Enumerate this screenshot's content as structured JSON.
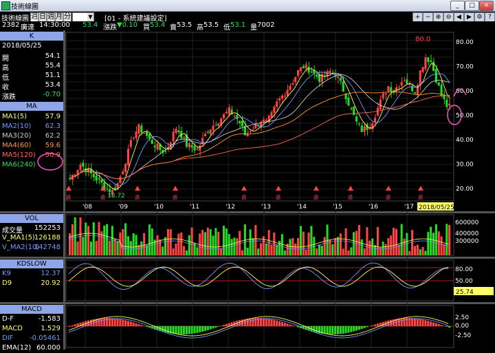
{
  "window": {
    "title": "技術線圖",
    "minimize": "_",
    "maximize": "□",
    "close": "×"
  },
  "toolbar": {
    "label": "技術線圖",
    "periods": [
      {
        "label": "週",
        "active": true
      },
      {
        "label": "日",
        "active": false
      },
      {
        "label": "週",
        "active": false
      },
      {
        "label": "月",
        "active": false
      },
      {
        "label": "分",
        "active": false
      }
    ],
    "settings": "[01 - 系統建議設定]"
  },
  "quote": {
    "code": "2382",
    "name": "廣達",
    "time": "14:30:00",
    "price": "53.4",
    "chg_label": "漲跌",
    "chg": "▼0.10",
    "bid_label": "買",
    "bid": "53.4",
    "ask_label": "賣",
    "ask": "53.5",
    "high_label": "高",
    "high": "53.5",
    "low_label": "低",
    "low": "53.1",
    "vol_label": "量",
    "vol": "7002"
  },
  "k_panel": {
    "header": "K",
    "date": "2018/05/25",
    "rows": [
      [
        "開",
        "54.1"
      ],
      [
        "高",
        "55.4"
      ],
      [
        "低",
        "51.1"
      ],
      [
        "收",
        "53.4"
      ],
      [
        "漲跌",
        "-0.70"
      ]
    ]
  },
  "ma_panel": {
    "header": "MA",
    "rows": [
      [
        "MA1(5)",
        "57.9",
        "#ffff66"
      ],
      [
        "MA2(10)",
        "62.3",
        "#6f9cff"
      ],
      [
        "MA3(20)",
        "62.2",
        "#cccccc"
      ],
      [
        "MA4(60)",
        "59.6",
        "#ff9933"
      ],
      [
        "MA5(120)",
        "50.9",
        "#ff6655"
      ],
      [
        "MA6(240)",
        "",
        "#33dd55"
      ]
    ]
  },
  "vol_panel": {
    "header": "VOL",
    "rows": [
      [
        "成交量",
        "152253",
        "#ffffff"
      ],
      [
        "V_MA1(5)",
        "126188",
        "#ffff66"
      ],
      [
        "V_MA2(10)",
        "142748",
        "#6f9cff"
      ]
    ]
  },
  "kd_panel": {
    "header": "KDSLOW",
    "rows": [
      [
        "K9",
        "12.37",
        "#6f9cff"
      ],
      [
        "D9",
        "20.92",
        "#ffff66"
      ]
    ]
  },
  "macd_panel": {
    "header": "MACD",
    "rows": [
      [
        "D-F",
        "-1.583",
        "#ffffff"
      ],
      [
        "MACD",
        "1.529",
        "#ffff66"
      ],
      [
        "DIF",
        "-0.05461",
        "#6f9cff"
      ],
      [
        "EMA(12)",
        "60.000",
        "#ffffff"
      ]
    ]
  },
  "chart_data": {
    "type": "candlestick",
    "years": [
      "'08",
      "'09",
      "'10",
      "'11",
      "'12",
      "'13",
      "'14",
      "'15",
      "'16",
      "'17"
    ],
    "current_date": "2018/05/25",
    "price_axis": {
      "ticks": [
        "80.00",
        "70.00",
        "60.00",
        "50.00",
        "40.00",
        "30.00",
        "20.00"
      ],
      "min": 15,
      "max": 84
    },
    "peak_label": "80.0",
    "trough_label": "18.72",
    "vol_axis": [
      "600000",
      "400000",
      "300000"
    ],
    "kd_axis": [
      "80.00",
      "50.00"
    ],
    "kd_current": "25.74",
    "macd_axis": [
      "2.50",
      "0.00",
      "-2.50"
    ],
    "signal_label": "週",
    "closes": [
      24,
      27,
      30,
      28,
      26,
      24,
      22,
      20,
      19,
      22,
      28,
      35,
      42,
      45,
      43,
      40,
      38,
      36,
      35,
      40,
      45,
      42,
      38,
      37,
      36,
      40,
      44,
      46,
      48,
      50,
      52,
      50,
      47,
      42,
      44,
      46,
      48,
      47,
      50,
      55,
      58,
      61,
      64,
      68,
      70,
      69,
      67,
      65,
      66,
      68,
      67,
      63,
      58,
      52,
      47,
      44,
      45,
      48,
      53,
      58,
      62,
      60,
      63,
      65,
      62,
      60,
      68,
      74,
      72,
      65,
      58,
      54,
      53
    ]
  }
}
